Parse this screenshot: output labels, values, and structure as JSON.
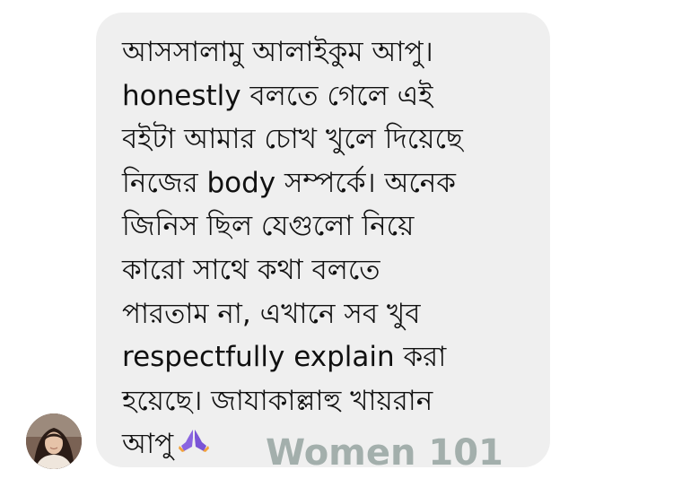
{
  "message": {
    "lines": [
      "আসসালামু আলাইকুম আপু।",
      "honestly বলতে গেলে এই",
      "বইটা আমার চোখ খুলে দিয়েছে",
      "নিজের body সম্পর্কে। অনেক",
      "জিনিস ছিল যেগুলো নিয়ে",
      "কারো সাথে কথা বলতে",
      "পারতাম না, এখানে সব খুব",
      "respectfully explain করা",
      "হয়েছে। জাযাকাল্লাহু খায়রান",
      "আপু"
    ],
    "trailing_emoji": "folded-hands-icon"
  },
  "sender": {
    "avatar_icon": "profile-photo"
  },
  "watermark": {
    "text": "Women 101"
  },
  "colors": {
    "bubble": "#efefef",
    "text": "#111111",
    "watermark": "#a3afac",
    "emoji": "#8a64e0"
  }
}
